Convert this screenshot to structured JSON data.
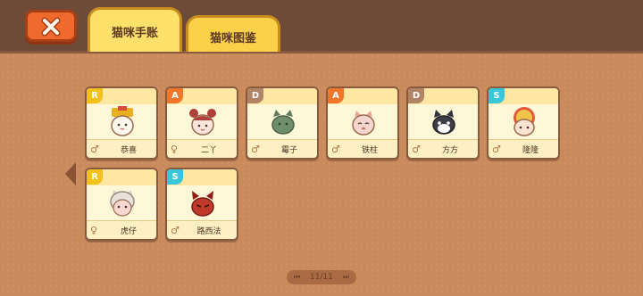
{
  "tabs": [
    {
      "label": "猫咪手账",
      "active": true
    },
    {
      "label": "猫咪图鉴",
      "active": false
    }
  ],
  "cats": [
    {
      "rank": "R",
      "gender": "♂",
      "name": "恭喜",
      "icon": "cat-emperor-icon",
      "color": "#f3d57a"
    },
    {
      "rank": "A",
      "gender": "♀",
      "name": "二丫",
      "icon": "cat-girl-buns-icon",
      "color": "#f7d2c4"
    },
    {
      "rank": "D",
      "gender": "♂",
      "name": "霉子",
      "icon": "cat-green-icon",
      "color": "#6f8f6a"
    },
    {
      "rank": "A",
      "gender": "♂",
      "name": "铁柱",
      "icon": "cat-pink-icon",
      "color": "#f4c6bf"
    },
    {
      "rank": "D",
      "gender": "♂",
      "name": "方方",
      "icon": "cat-tuxedo-icon",
      "color": "#3d3d46"
    },
    {
      "rank": "S",
      "gender": "♂",
      "name": "隆隆",
      "icon": "cat-lion-dance-icon",
      "color": "#f0c8b0"
    },
    {
      "rank": "R",
      "gender": "♀",
      "name": "虎仔",
      "icon": "cat-tiger-hood-icon",
      "color": "#f5c9c9"
    },
    {
      "rank": "S",
      "gender": "♂",
      "name": "路西法",
      "icon": "cat-devil-icon",
      "color": "#c0392b"
    }
  ],
  "pagination": {
    "label": "11/11"
  },
  "colors": {
    "accent": "#fcd14a",
    "close": "#ef6a2c",
    "bar": "#6e4a38"
  }
}
